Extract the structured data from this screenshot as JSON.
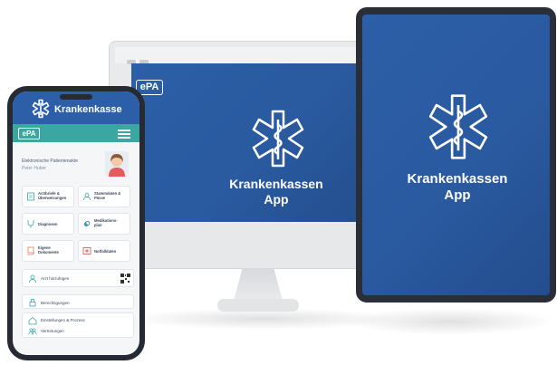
{
  "monitor": {
    "badge": "ePA",
    "title_line1": "Krankenkassen",
    "title_line2": "App"
  },
  "tablet": {
    "title_line1": "Krankenkassen",
    "title_line2": "App"
  },
  "phone": {
    "brand": "Krankenkasse",
    "badge": "ePA",
    "patient_label": "Elektronische Patientenakte",
    "patient_name": "Peter Huber",
    "tiles": [
      {
        "label": "Arztbriefe & Überweisungen"
      },
      {
        "label": "Stammdaten & Pässe"
      },
      {
        "label": "Diagnosen"
      },
      {
        "label": "Medikations-plan"
      },
      {
        "label": "Eigene Dokumente"
      },
      {
        "label": "Notfalldaten"
      }
    ],
    "rows": [
      {
        "label": "Arzt hinzufügen"
      },
      {
        "label": "Berechtigungen"
      },
      {
        "label": "Einstellungen & Prozess"
      },
      {
        "label": "Vertretungen"
      }
    ]
  },
  "colors": {
    "screen_blue": "#2a5aa0",
    "teal": "#3aa7a0",
    "device_dark": "#262a33"
  }
}
